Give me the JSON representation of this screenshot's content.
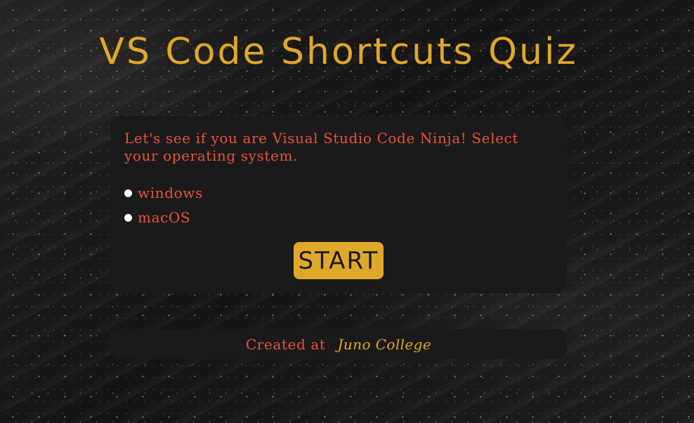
{
  "page": {
    "title": "VS Code Shortcuts Quiz"
  },
  "quiz": {
    "prompt": "Let's see if you are Visual Studio Code Ninja! Select your operating system.",
    "options": [
      {
        "label": "windows",
        "selected": false
      },
      {
        "label": "macOS",
        "selected": false
      }
    ],
    "start_label": "START"
  },
  "footer": {
    "text": "Created at",
    "link_label": "Juno College"
  },
  "colors": {
    "accent_gold": "#e0a82a",
    "accent_red": "#e8553b",
    "card_bg": "#1a1a1a"
  }
}
